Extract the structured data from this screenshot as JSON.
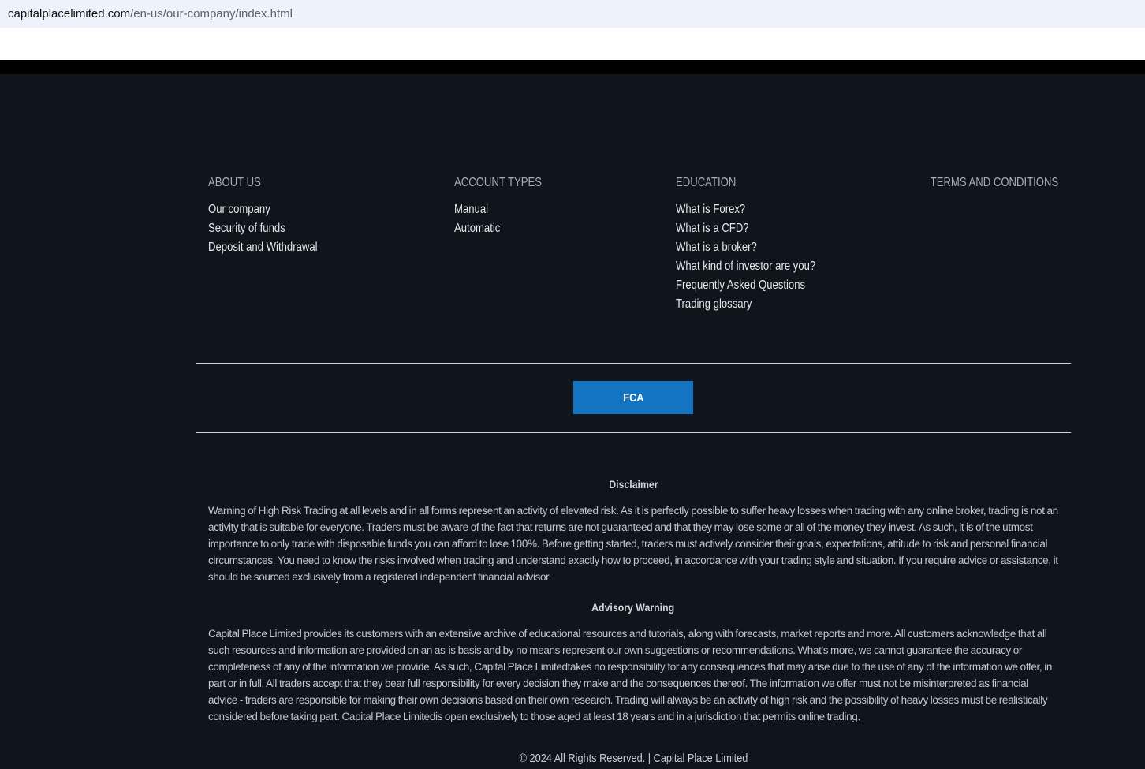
{
  "browser": {
    "url_domain": "capitalplacelimited.com",
    "url_path": "/en-us/our-company/index.html"
  },
  "footer": {
    "columns": [
      {
        "heading": "ABOUT US",
        "links": [
          "Our company",
          "Security of funds",
          "Deposit and Withdrawal"
        ]
      },
      {
        "heading": "ACCOUNT TYPES",
        "links": [
          "Manual",
          "Automatic"
        ]
      },
      {
        "heading": "EDUCATION",
        "links": [
          "What is Forex?",
          "What is a CFD?",
          "What is a broker?",
          "What kind of investor are you?",
          "Frequently Asked Questions",
          "Trading glossary"
        ]
      },
      {
        "heading": "TERMS AND CONDITIONS",
        "links": []
      }
    ],
    "fca_button": "FCA",
    "disclaimer": {
      "title": "Disclaimer",
      "text": "Warning of High Risk Trading at all levels and in all forms represent an activity of elevated risk. As it is perfectly possible to suffer heavy losses when trading with any online broker, trading is not an activity that is suitable for everyone. Traders must be aware of the fact that returns are not guaranteed and that they may lose some or all of the money they invest. As such, it is of the utmost importance to only trade with disposable funds you can afford to lose 100%. Before getting started, traders must actively consider their goals, expectations, attitude to risk and personal financial circumstances. You need to know the risks involved when trading and understand exactly how to proceed, in accordance with your trading style and situation. If you require advice or assistance, it should be sourced exclusively from a registered independent financial advisor."
    },
    "advisory": {
      "title": "Advisory Warning",
      "text": "Capital Place Limited provides its customers with an extensive archive of educational resources and tutorials, along with forecasts, market reports and more. All customers acknowledge that all such resources and information are provided on an as-is basis and by no means represent our own suggestions or recommendations. What's more, we cannot guarantee the accuracy or completeness of any of the information we provide. As such, Capital Place Limitedtakes no responsibility for any consequences that may arise due to the use of any of the information we offer, in part or in full. All traders accept that they bear full responsibility for every decision they make and the consequences thereof. The information we offer must not be misinterpreted as financial advice - traders are responsible for making their own decisions based on their own research. Trading will always be an activity of high risk and the possibility of heavy losses must be realistically considered before taking part. Capital Place Limitedis open exclusively to those aged at least 18 years and in a jurisdiction that permits online trading."
    },
    "copyright": "© 2024 All Rights Reserved. | Capital Place Limited"
  }
}
